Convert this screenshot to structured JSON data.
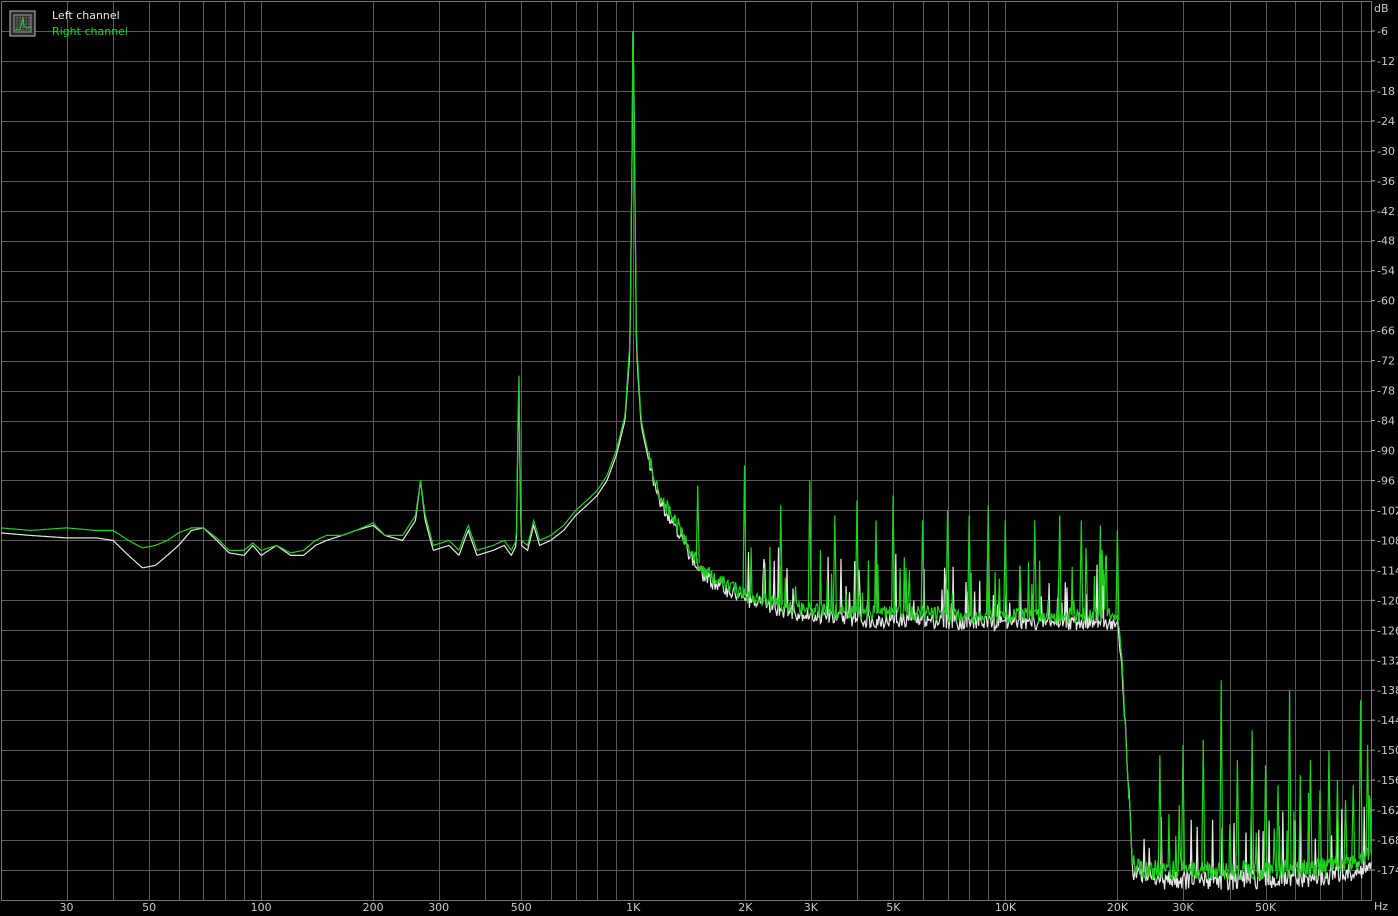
{
  "chart_data": {
    "type": "line",
    "xlabel": "Hz",
    "ylabel": "dB",
    "x_scale": "log",
    "xlim": [
      20,
      96000
    ],
    "ylim": [
      -180,
      0
    ],
    "grid": true,
    "legend_placement": "top-left",
    "x_ticks": [
      {
        "value": 30,
        "label": "30"
      },
      {
        "value": 50,
        "label": "50"
      },
      {
        "value": 100,
        "label": "100"
      },
      {
        "value": 200,
        "label": "200"
      },
      {
        "value": 300,
        "label": "300"
      },
      {
        "value": 500,
        "label": "500"
      },
      {
        "value": 1000,
        "label": "1K"
      },
      {
        "value": 2000,
        "label": "2K"
      },
      {
        "value": 3000,
        "label": "3K"
      },
      {
        "value": 5000,
        "label": "5K"
      },
      {
        "value": 10000,
        "label": "10K"
      },
      {
        "value": 20000,
        "label": "20K"
      },
      {
        "value": 30000,
        "label": "30K"
      },
      {
        "value": 50000,
        "label": "50K"
      }
    ],
    "y_ticks": [
      -6,
      -12,
      -18,
      -24,
      -30,
      -36,
      -42,
      -48,
      -54,
      -60,
      -66,
      -72,
      -78,
      -84,
      -90,
      -96,
      -102,
      -108,
      -114,
      -120,
      -126,
      -132,
      -138,
      -144,
      -150,
      -156,
      -162,
      -168,
      -174
    ],
    "series": [
      {
        "name": "Left channel",
        "color": "#e6e6e6",
        "points": [
          [
            20,
            -106.5
          ],
          [
            24,
            -107
          ],
          [
            30,
            -107.5
          ],
          [
            36,
            -107.5
          ],
          [
            40,
            -108
          ],
          [
            44,
            -111
          ],
          [
            48,
            -113.5
          ],
          [
            52,
            -113
          ],
          [
            56,
            -111
          ],
          [
            60,
            -109
          ],
          [
            65,
            -106
          ],
          [
            70,
            -105.5
          ],
          [
            76,
            -108
          ],
          [
            82,
            -110.5
          ],
          [
            90,
            -111
          ],
          [
            95,
            -109
          ],
          [
            100,
            -111
          ],
          [
            110,
            -109
          ],
          [
            120,
            -111
          ],
          [
            130,
            -111
          ],
          [
            140,
            -109
          ],
          [
            150,
            -108
          ],
          [
            165,
            -107
          ],
          [
            180,
            -106
          ],
          [
            200,
            -105
          ],
          [
            215,
            -107
          ],
          [
            240,
            -108
          ],
          [
            260,
            -104
          ],
          [
            268,
            -96
          ],
          [
            276,
            -104
          ],
          [
            290,
            -110
          ],
          [
            320,
            -109
          ],
          [
            340,
            -111
          ],
          [
            360,
            -106
          ],
          [
            380,
            -111
          ],
          [
            420,
            -110
          ],
          [
            450,
            -109
          ],
          [
            470,
            -111
          ],
          [
            485,
            -109
          ],
          [
            492,
            -78
          ],
          [
            500,
            -109
          ],
          [
            520,
            -110
          ],
          [
            540,
            -105
          ],
          [
            560,
            -109
          ],
          [
            600,
            -108
          ],
          [
            650,
            -106
          ],
          [
            700,
            -103
          ],
          [
            750,
            -101
          ],
          [
            800,
            -99
          ],
          [
            850,
            -96
          ],
          [
            900,
            -91
          ],
          [
            950,
            -84
          ],
          [
            980,
            -70
          ],
          [
            1000,
            -6
          ],
          [
            1020,
            -70
          ],
          [
            1050,
            -85
          ],
          [
            1100,
            -92
          ],
          [
            1150,
            -98
          ],
          [
            1200,
            -101
          ],
          [
            1300,
            -105
          ],
          [
            1400,
            -110
          ],
          [
            1500,
            -114
          ],
          [
            1600,
            -116
          ],
          [
            1800,
            -118
          ],
          [
            2000,
            -120
          ],
          [
            2500,
            -122
          ],
          [
            3000,
            -123
          ],
          [
            4000,
            -124
          ],
          [
            5000,
            -124
          ],
          [
            6000,
            -124
          ],
          [
            8000,
            -124.5
          ],
          [
            10000,
            -124.5
          ],
          [
            15000,
            -124.5
          ],
          [
            19000,
            -124.5
          ],
          [
            20000,
            -125
          ],
          [
            20500,
            -133
          ],
          [
            21000,
            -145
          ],
          [
            21500,
            -160
          ],
          [
            22000,
            -175
          ],
          [
            25000,
            -176
          ],
          [
            30000,
            -176
          ],
          [
            40000,
            -176
          ],
          [
            60000,
            -176
          ],
          [
            80000,
            -175
          ],
          [
            96000,
            -174
          ]
        ]
      },
      {
        "name": "Right channel",
        "color": "#1ed21e",
        "points": [
          [
            20,
            -105.5
          ],
          [
            24,
            -106
          ],
          [
            30,
            -105.5
          ],
          [
            36,
            -106
          ],
          [
            40,
            -106
          ],
          [
            44,
            -108
          ],
          [
            48,
            -109.5
          ],
          [
            52,
            -109
          ],
          [
            56,
            -108
          ],
          [
            60,
            -106.5
          ],
          [
            65,
            -105.5
          ],
          [
            70,
            -105.5
          ],
          [
            76,
            -107.5
          ],
          [
            82,
            -110
          ],
          [
            90,
            -110
          ],
          [
            95,
            -108.5
          ],
          [
            100,
            -110
          ],
          [
            110,
            -109
          ],
          [
            120,
            -110.5
          ],
          [
            130,
            -110
          ],
          [
            140,
            -108
          ],
          [
            150,
            -107
          ],
          [
            165,
            -107
          ],
          [
            180,
            -106
          ],
          [
            200,
            -104.5
          ],
          [
            215,
            -107
          ],
          [
            240,
            -107
          ],
          [
            260,
            -103
          ],
          [
            268,
            -96
          ],
          [
            276,
            -103
          ],
          [
            290,
            -109
          ],
          [
            320,
            -108
          ],
          [
            340,
            -110
          ],
          [
            360,
            -105
          ],
          [
            380,
            -110
          ],
          [
            420,
            -109
          ],
          [
            450,
            -108
          ],
          [
            470,
            -110
          ],
          [
            485,
            -108
          ],
          [
            492,
            -75
          ],
          [
            500,
            -108
          ],
          [
            520,
            -109
          ],
          [
            540,
            -104
          ],
          [
            560,
            -108
          ],
          [
            600,
            -107
          ],
          [
            650,
            -105
          ],
          [
            700,
            -102
          ],
          [
            750,
            -100
          ],
          [
            800,
            -98
          ],
          [
            850,
            -95
          ],
          [
            900,
            -90
          ],
          [
            950,
            -83
          ],
          [
            980,
            -68
          ],
          [
            1000,
            -6
          ],
          [
            1020,
            -68
          ],
          [
            1050,
            -84
          ],
          [
            1100,
            -91
          ],
          [
            1150,
            -97
          ],
          [
            1200,
            -100
          ],
          [
            1300,
            -104
          ],
          [
            1400,
            -109
          ],
          [
            1500,
            -113
          ],
          [
            1600,
            -115
          ],
          [
            1800,
            -117
          ],
          [
            2000,
            -119
          ],
          [
            2500,
            -121
          ],
          [
            3000,
            -122
          ],
          [
            4000,
            -122.5
          ],
          [
            5000,
            -122.5
          ],
          [
            6000,
            -122.5
          ],
          [
            8000,
            -123
          ],
          [
            10000,
            -123
          ],
          [
            15000,
            -123
          ],
          [
            19000,
            -123
          ],
          [
            20000,
            -124
          ],
          [
            20500,
            -131
          ],
          [
            21000,
            -145
          ],
          [
            21500,
            -160
          ],
          [
            22000,
            -173
          ],
          [
            25000,
            -174
          ],
          [
            30000,
            -174
          ],
          [
            40000,
            -174
          ],
          [
            60000,
            -174
          ],
          [
            80000,
            -173
          ],
          [
            96000,
            -171
          ]
        ],
        "spurs": [
          [
            1490,
            -97
          ],
          [
            1990,
            -93
          ],
          [
            2490,
            -101
          ],
          [
            2980,
            -96
          ],
          [
            3480,
            -103
          ],
          [
            3990,
            -100
          ],
          [
            4490,
            -104
          ],
          [
            4990,
            -99
          ],
          [
            5990,
            -104
          ],
          [
            6990,
            -102
          ],
          [
            7990,
            -103
          ],
          [
            8990,
            -101
          ],
          [
            9990,
            -104
          ],
          [
            11990,
            -104
          ],
          [
            13990,
            -103
          ],
          [
            15990,
            -104
          ],
          [
            17990,
            -105
          ],
          [
            19990,
            -106
          ],
          [
            26000,
            -151
          ],
          [
            30000,
            -149
          ],
          [
            34000,
            -148
          ],
          [
            38000,
            -136
          ],
          [
            42000,
            -152
          ],
          [
            46000,
            -146
          ],
          [
            50000,
            -153
          ],
          [
            54000,
            -157
          ],
          [
            58000,
            -138
          ],
          [
            62000,
            -155
          ],
          [
            66000,
            -152
          ],
          [
            70000,
            -158
          ],
          [
            74000,
            -150
          ],
          [
            78000,
            -156
          ],
          [
            82000,
            -160
          ],
          [
            86000,
            -157
          ],
          [
            90000,
            -140
          ],
          [
            94000,
            -149
          ]
        ]
      }
    ]
  },
  "axis_labels": {
    "y_unit": "dB",
    "x_unit": "Hz"
  },
  "legend": {
    "items": [
      {
        "label": "Left channel",
        "color": "#e6e6e6"
      },
      {
        "label": "Right channel",
        "color": "#1ed21e"
      }
    ],
    "icon": "spectrum-grid-icon"
  }
}
